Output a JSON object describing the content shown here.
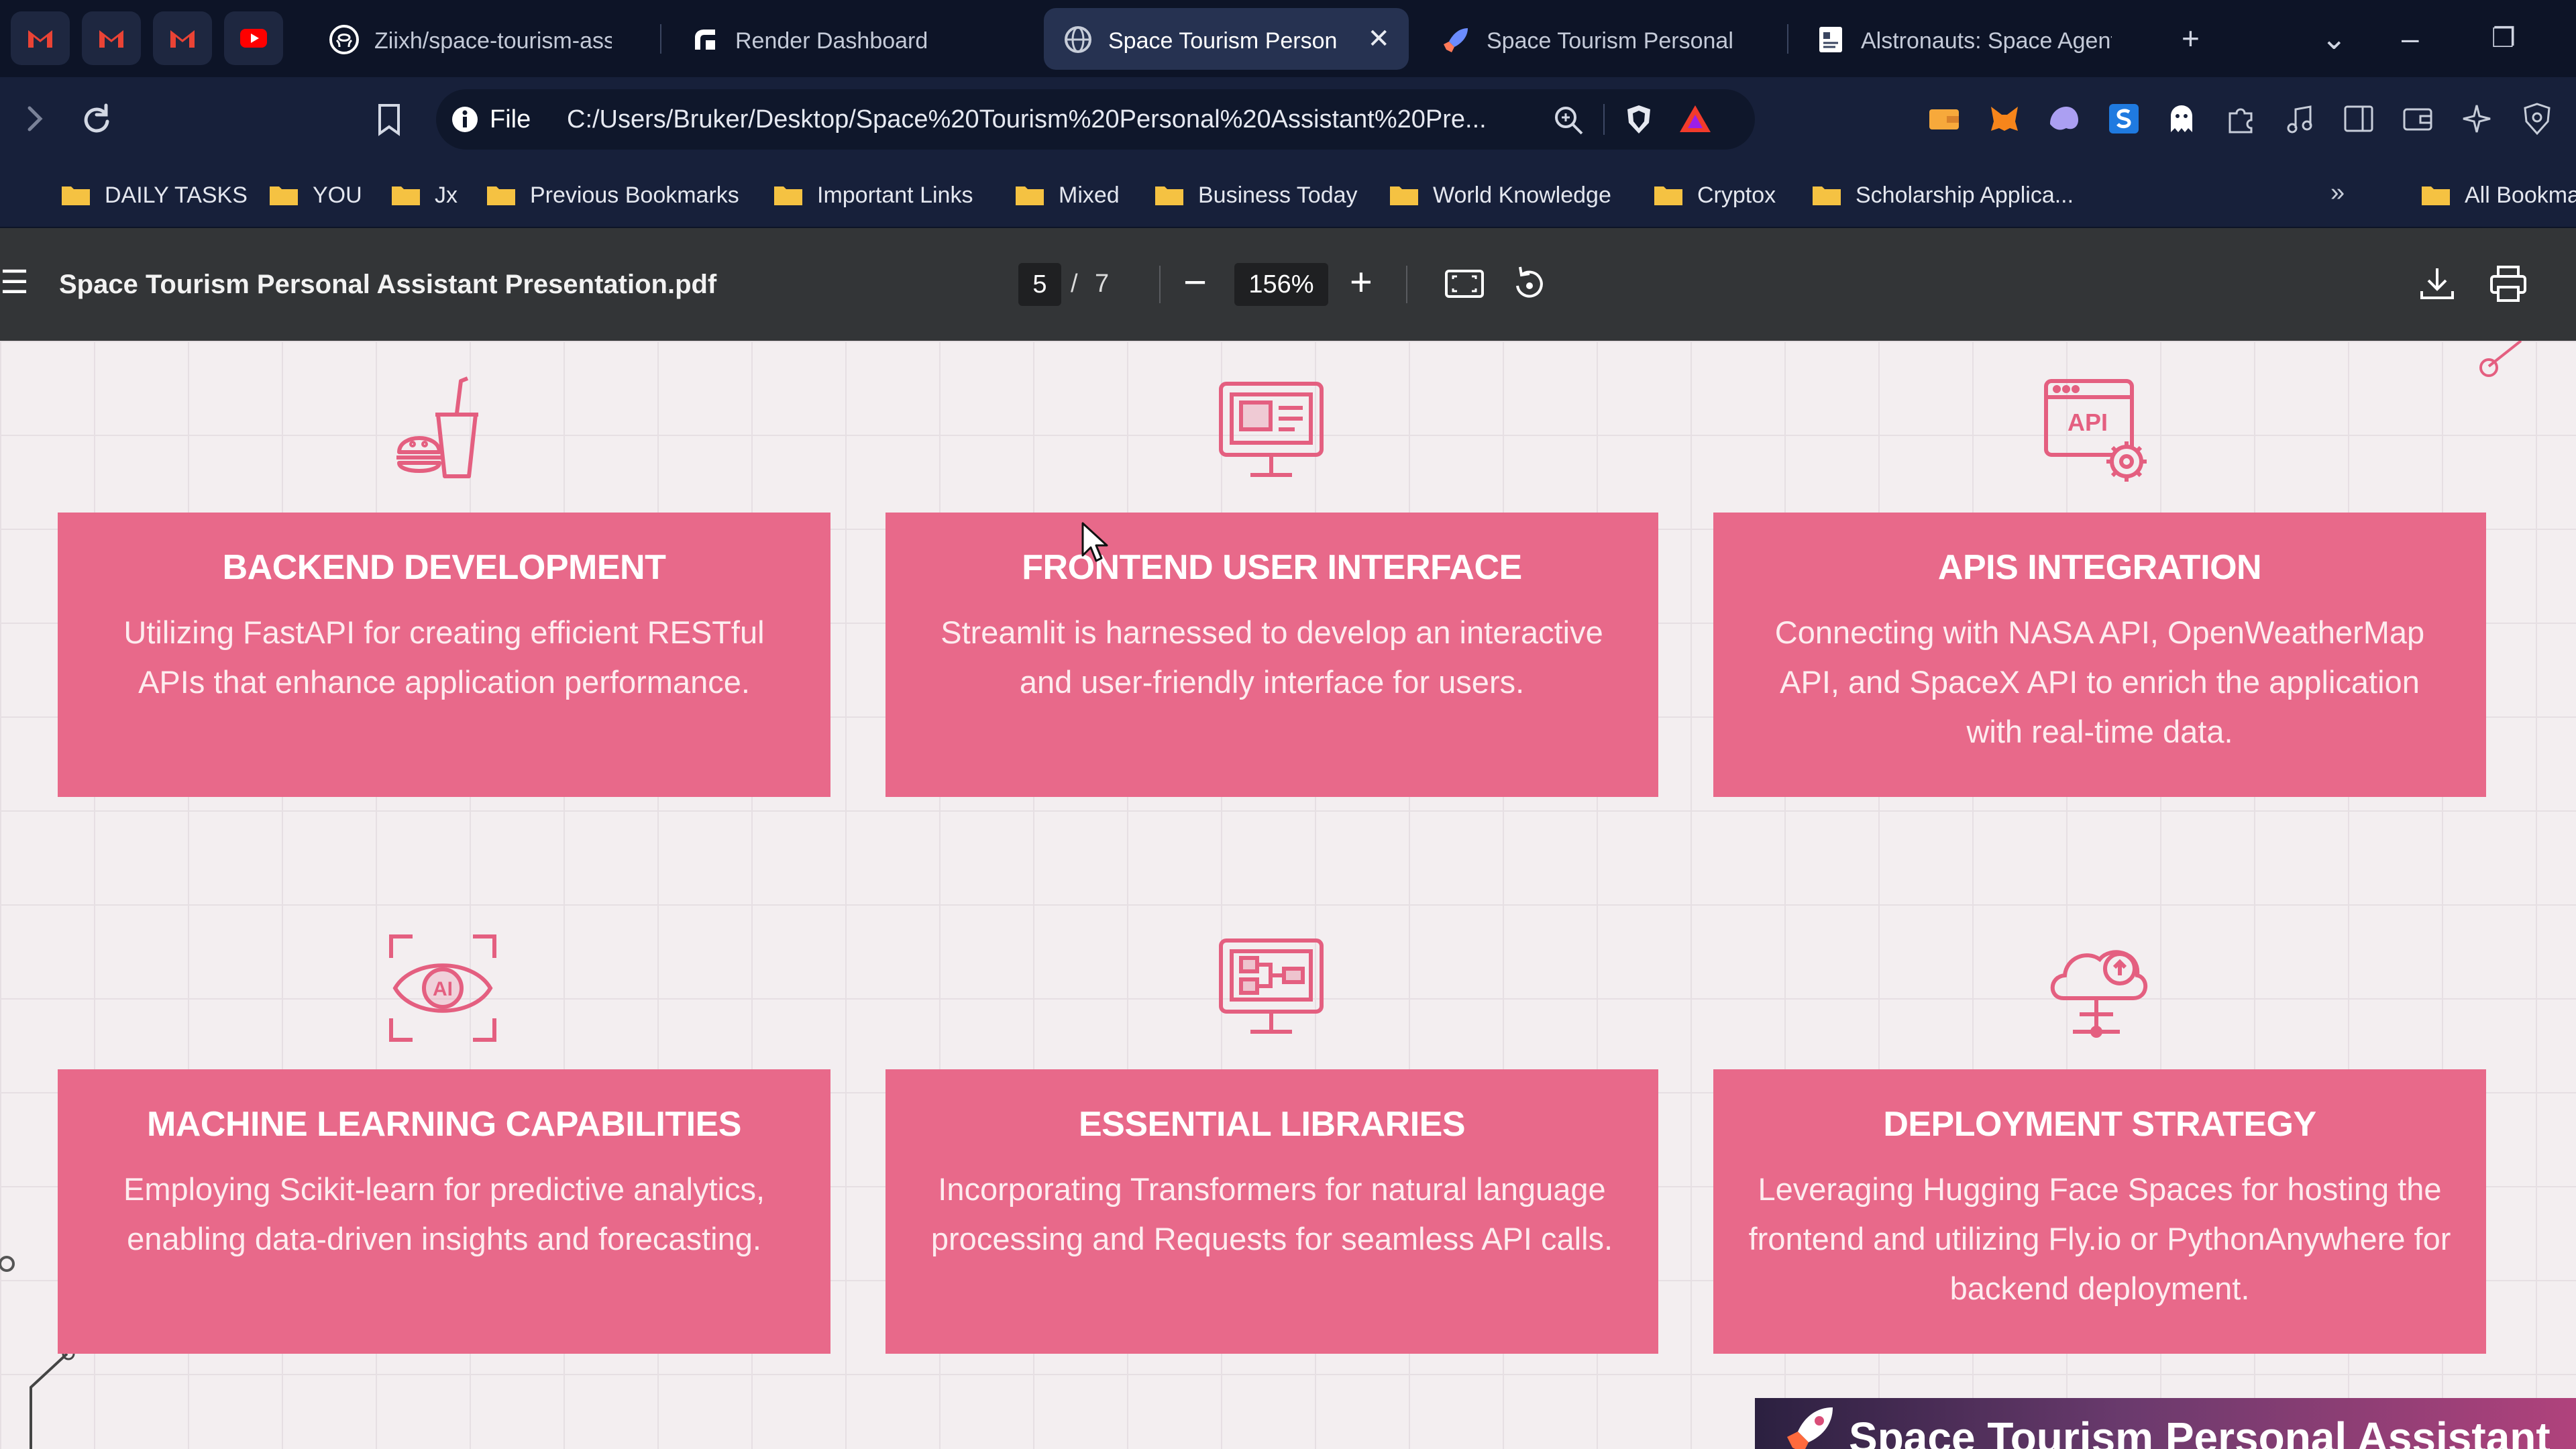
{
  "browser": {
    "pinned_tabs": [
      {
        "icon": "gmail-icon"
      },
      {
        "icon": "gmail-icon"
      },
      {
        "icon": "gmail-icon"
      },
      {
        "icon": "youtube-icon"
      }
    ],
    "tabs": [
      {
        "title": "Ziixh/space-tourism-assist",
        "icon": "github-icon",
        "active": false
      },
      {
        "title": "Render Dashboard",
        "icon": "render-icon",
        "active": false
      },
      {
        "title": "Space Tourism Person",
        "icon": "globe-icon",
        "active": true
      },
      {
        "title": "Space Tourism Personal A",
        "icon": "rocket-icon",
        "active": false
      },
      {
        "title": "Alstronauts: Space Agents",
        "icon": "document-icon",
        "active": false
      }
    ],
    "new_tab_label": "+",
    "address": {
      "scheme_label": "File",
      "url": "C:/Users/Bruker/Desktop/Space%20Tourism%20Personal%20Assistant%20Pre..."
    },
    "bookmarks": [
      "DAILY TASKS",
      "YOU",
      "Jx",
      "Previous Bookmarks",
      "Important Links",
      "Mixed",
      "Business Today",
      "World Knowledge",
      "Cryptox",
      "Scholarship Applica..."
    ],
    "bookmarks_overflow": "»",
    "all_bookmarks_label": "All Bookma"
  },
  "pdf_viewer": {
    "file_name": "Space Tourism Personal Assistant Presentation.pdf",
    "current_page": "5",
    "page_separator": "/",
    "total_pages": "7",
    "zoom": "156%"
  },
  "slide": {
    "cards": [
      {
        "title": "BACKEND DEVELOPMENT",
        "description": "Utilizing FastAPI for creating efficient RESTful APIs that enhance application performance.",
        "icon": "fast-food-icon"
      },
      {
        "title": "FRONTEND USER INTERFACE",
        "description": "Streamlit is harnessed to develop an interactive and user-friendly interface for users.",
        "icon": "monitor-icon"
      },
      {
        "title": "APIS INTEGRATION",
        "description": "Connecting with NASA API, OpenWeatherMap API, and SpaceX API to enrich the application with real-time data.",
        "icon": "api-gear-icon"
      },
      {
        "title": "MACHINE LEARNING CAPABILITIES",
        "description": "Employing Scikit-learn for predictive analytics, enabling data-driven insights and forecasting.",
        "icon": "ai-eye-icon"
      },
      {
        "title": "ESSENTIAL LIBRARIES",
        "description": "Incorporating Transformers for natural language processing and Requests for seamless API calls.",
        "icon": "monitor-diagram-icon"
      },
      {
        "title": "DEPLOYMENT STRATEGY",
        "description": "Leveraging Hugging Face Spaces for hosting the frontend and utilizing Fly.io or PythonAnywhere for backend deployment.",
        "icon": "cloud-upload-icon"
      }
    ],
    "banner_title": "Space Tourism Personal Assistant"
  },
  "colors": {
    "card": "#e8698a",
    "icon_stroke": "#e45f80",
    "tab_bar": "#0d1427",
    "toolbar": "#17203a",
    "pdf_toolbar": "#333537"
  }
}
